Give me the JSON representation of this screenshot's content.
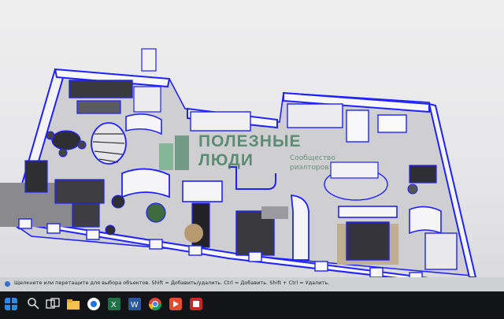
{
  "status_bar": {
    "hint": "Щелкните или перетащите для выбора объектов. Shift = Добавить/удалить. Ctrl = Добавить. Shift + Ctrl = Удалить."
  },
  "watermark": {
    "line1": "ПОЛЕЗНЫЕ",
    "line2": "ЛЮДИ",
    "sub1": "Сообщество",
    "sub2": "риэлторов"
  },
  "taskbar": {
    "apps": [
      "start",
      "search",
      "file-explorer",
      "spreadsheet",
      "word",
      "chrome",
      "media",
      "app"
    ]
  },
  "colors": {
    "selection": "#1f22ff",
    "wall": "#ffffff",
    "taskbar": "#121417",
    "watermark": "#3c7a59"
  }
}
